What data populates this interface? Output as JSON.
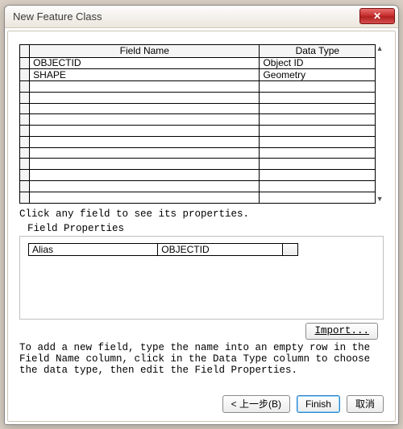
{
  "window": {
    "title": "New Feature Class"
  },
  "grid": {
    "headers": {
      "field_name": "Field Name",
      "data_type": "Data Type"
    },
    "rows": [
      {
        "name": "OBJECTID",
        "type": "Object ID"
      },
      {
        "name": "SHAPE",
        "type": "Geometry"
      },
      {
        "name": "",
        "type": ""
      },
      {
        "name": "",
        "type": ""
      },
      {
        "name": "",
        "type": ""
      },
      {
        "name": "",
        "type": ""
      },
      {
        "name": "",
        "type": ""
      },
      {
        "name": "",
        "type": ""
      },
      {
        "name": "",
        "type": ""
      },
      {
        "name": "",
        "type": ""
      },
      {
        "name": "",
        "type": ""
      },
      {
        "name": "",
        "type": ""
      },
      {
        "name": "",
        "type": ""
      }
    ]
  },
  "hint": "Click any field to see its properties.",
  "properties": {
    "label": "Field Properties",
    "rows": [
      {
        "key": "Alias",
        "value": "OBJECTID"
      }
    ]
  },
  "import_label": "Import...",
  "instructions": "To add a new field, type the name into an empty row in the Field Name column, click in the Data Type column to choose the data type, then edit the Field Properties.",
  "buttons": {
    "back": "< 上一步(B)",
    "finish": "Finish",
    "cancel": "取消"
  }
}
